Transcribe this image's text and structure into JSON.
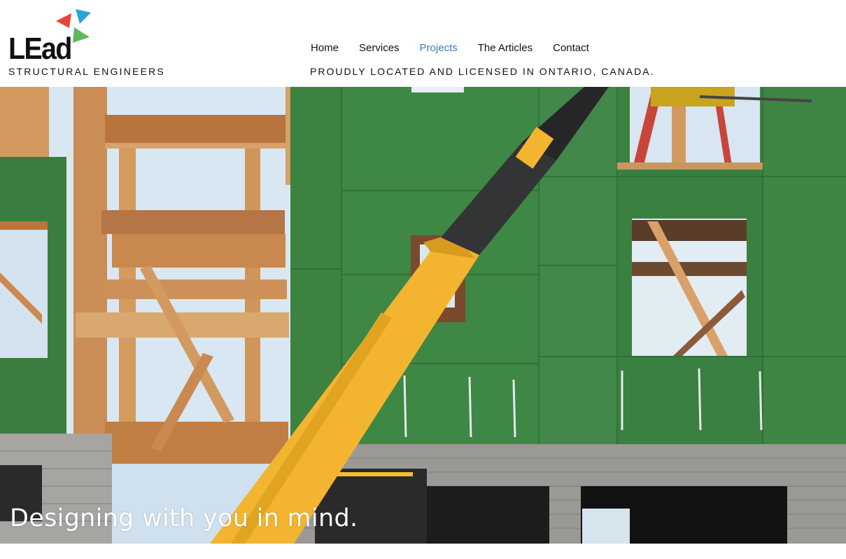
{
  "brand": {
    "logo_text": "LEad",
    "tagline": "STRUCTURAL ENGINEERS",
    "colors": {
      "red": "#e8463b",
      "blue": "#2aa6d6",
      "green": "#5cb85c"
    }
  },
  "nav": {
    "items": [
      {
        "label": "Home",
        "active": false
      },
      {
        "label": "Services",
        "active": false
      },
      {
        "label": "Projects",
        "active": true
      },
      {
        "label": "The Articles",
        "active": false
      },
      {
        "label": "Contact",
        "active": false
      }
    ],
    "active_color": "#3a7bbd"
  },
  "header": {
    "location_tagline": "PROUDLY LOCATED AND LICENSED IN ONTARIO, CANADA."
  },
  "hero": {
    "caption": "Designing with you in mind.",
    "image_subject": "construction-site-with-crane-photo"
  }
}
